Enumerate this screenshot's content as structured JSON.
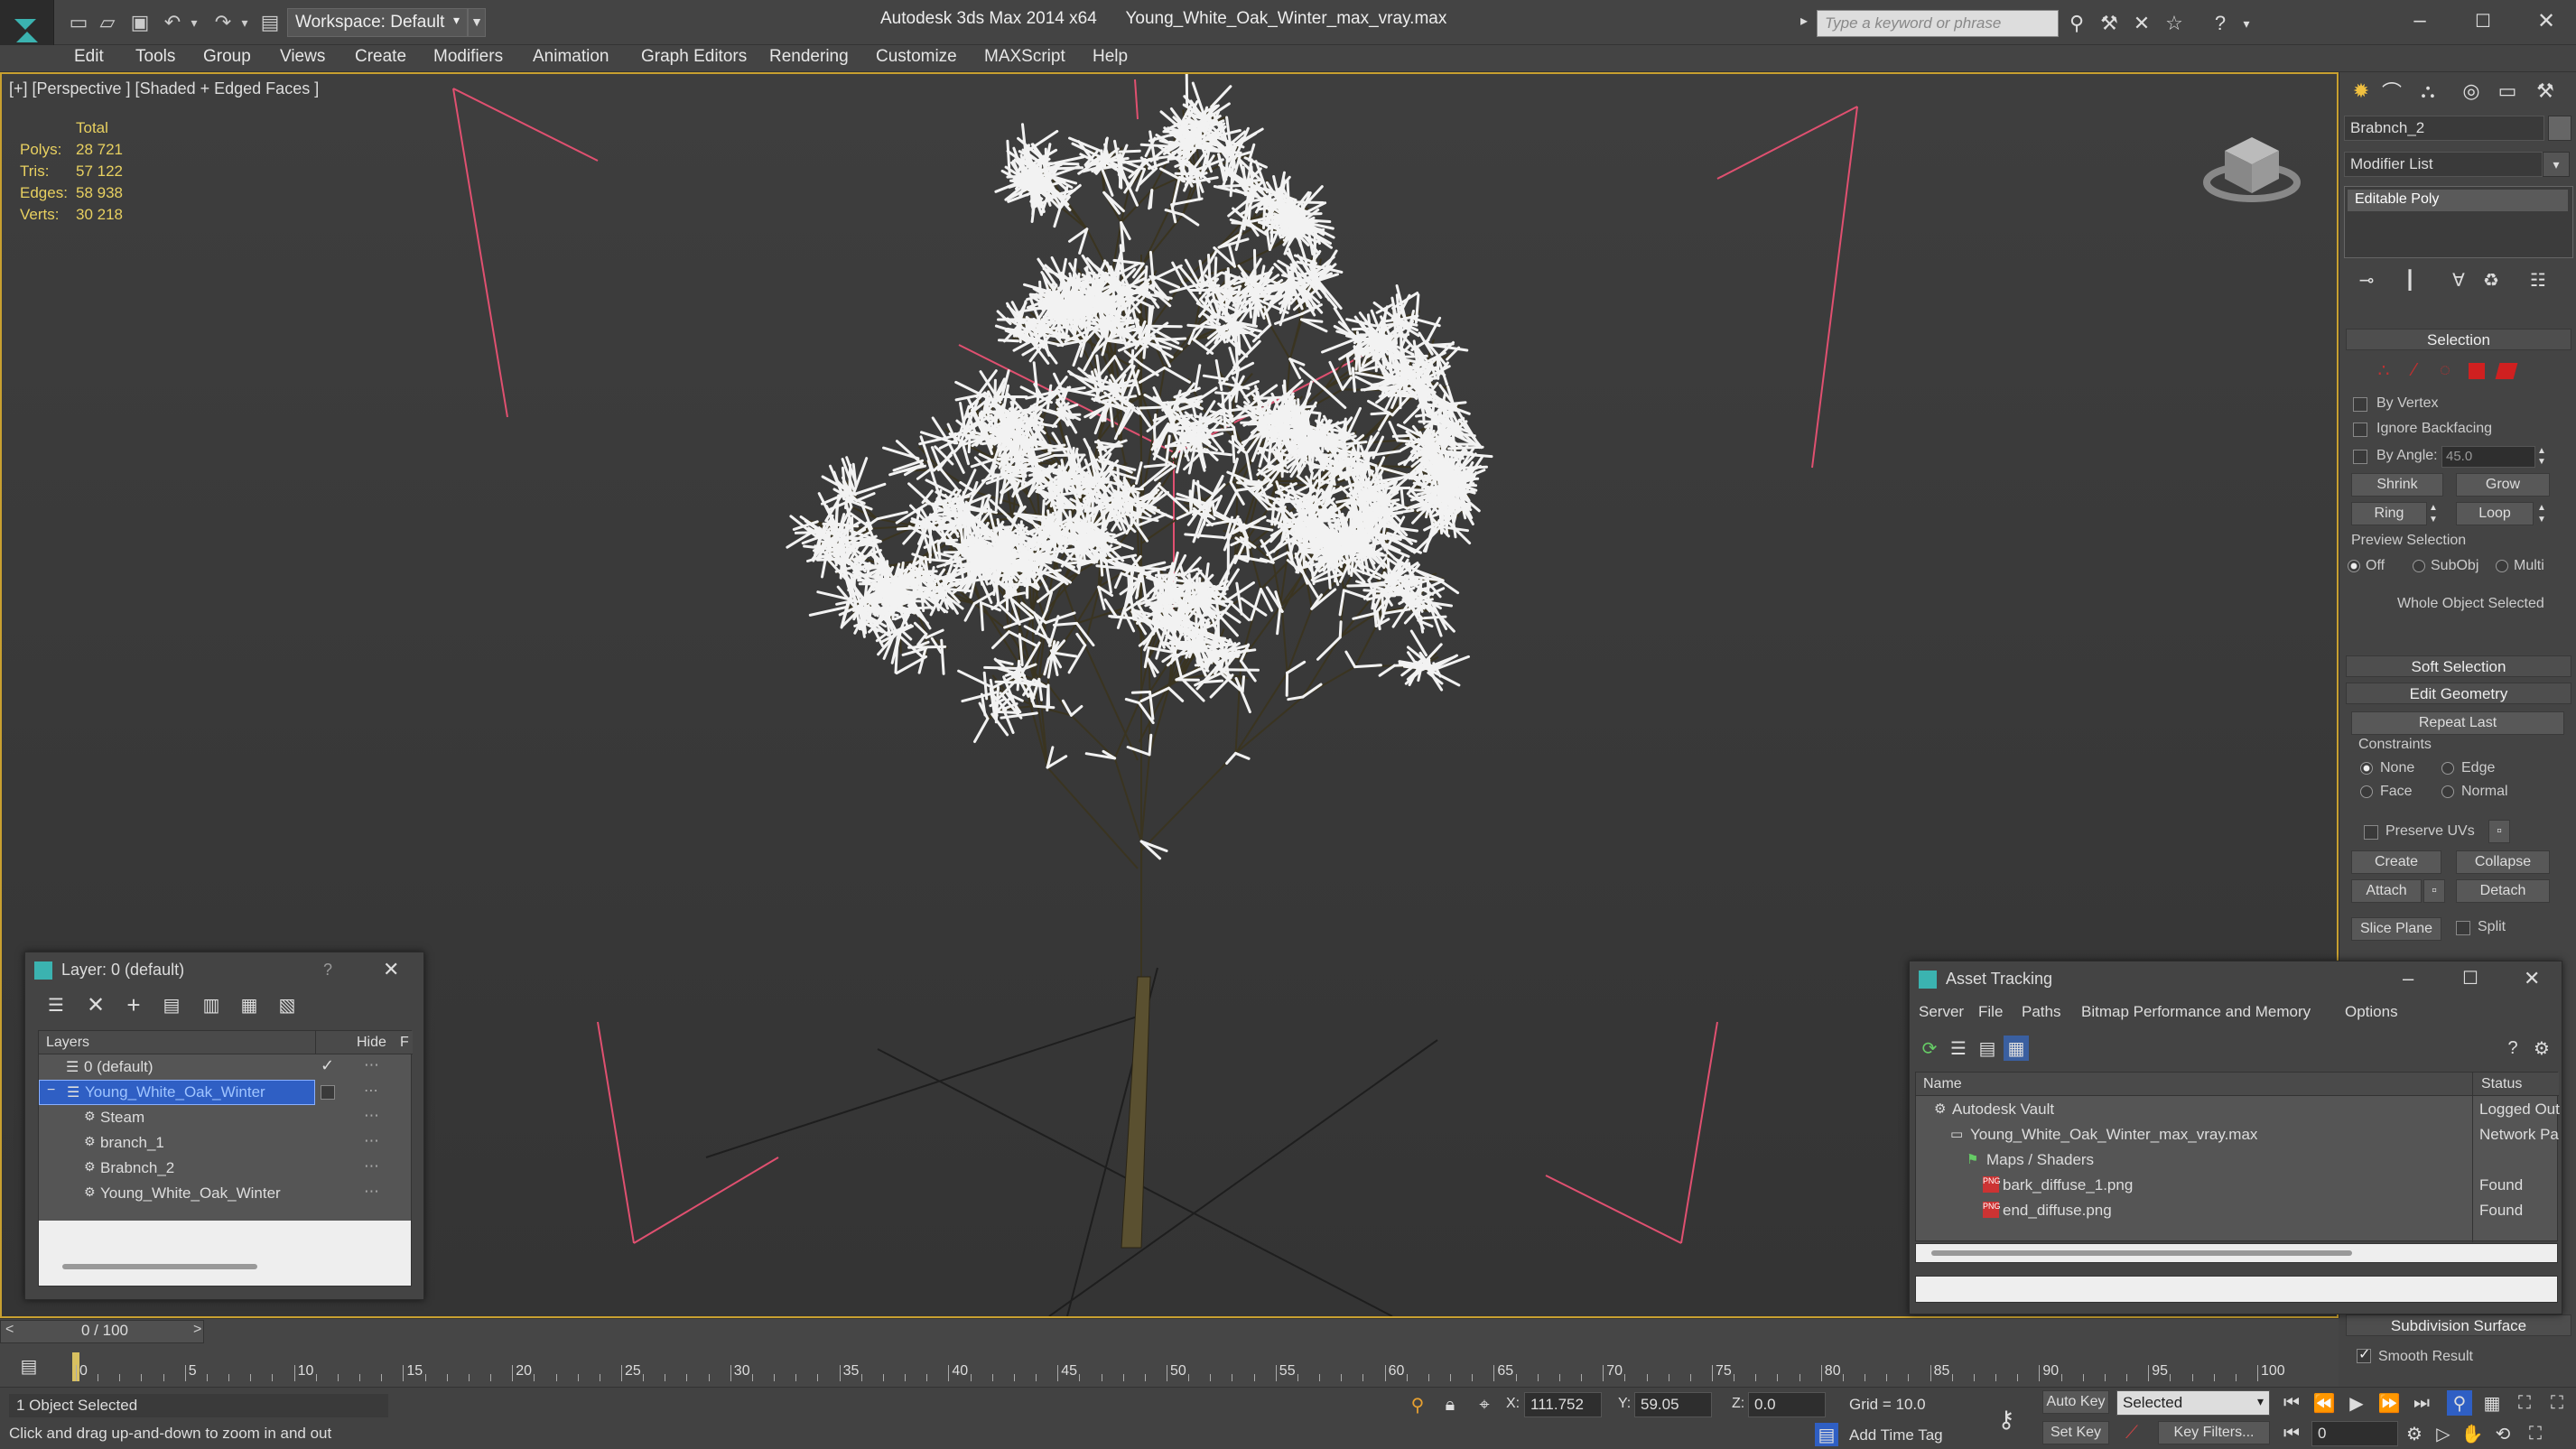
{
  "titlebar": {
    "workspace": "Workspace: Default",
    "app_title": "Autodesk 3ds Max  2014 x64",
    "file_title": "Young_White_Oak_Winter_max_vray.max",
    "search_placeholder": "Type a keyword or phrase"
  },
  "menu": [
    "Edit",
    "Tools",
    "Group",
    "Views",
    "Create",
    "Modifiers",
    "Animation",
    "Graph Editors",
    "Rendering",
    "Customize",
    "MAXScript",
    "Help"
  ],
  "viewport": {
    "label": "[+] [Perspective ] [Shaded + Edged Faces ]",
    "stats_header": "Total",
    "stats": [
      {
        "label": "Polys:",
        "value": "28 721"
      },
      {
        "label": "Tris:",
        "value": "57 122"
      },
      {
        "label": "Edges:",
        "value": "58 938"
      },
      {
        "label": "Verts:",
        "value": "30 218"
      }
    ]
  },
  "command_panel": {
    "object_name": "Brabnch_2",
    "modifier_list": "Modifier List",
    "stack_item": "Editable Poly",
    "selection_header": "Selection",
    "by_vertex": "By Vertex",
    "ignore_backfacing": "Ignore Backfacing",
    "by_angle": "By Angle:",
    "angle_value": "45.0",
    "shrink": "Shrink",
    "grow": "Grow",
    "ring": "Ring",
    "loop": "Loop",
    "preview_selection": "Preview Selection",
    "preview_off": "Off",
    "preview_subobj": "SubObj",
    "preview_multi": "Multi",
    "whole_object": "Whole Object Selected",
    "soft_selection": "Soft Selection",
    "edit_geometry": "Edit Geometry",
    "repeat_last": "Repeat Last",
    "constraints": "Constraints",
    "c_none": "None",
    "c_edge": "Edge",
    "c_face": "Face",
    "c_normal": "Normal",
    "preserve_uvs": "Preserve UVs",
    "create": "Create",
    "collapse": "Collapse",
    "attach": "Attach",
    "detach": "Detach",
    "slice_plane": "Slice Plane",
    "split": "Split",
    "subdivision_surface": "Subdivision Surface",
    "smooth_result": "Smooth Result"
  },
  "layer_dialog": {
    "title": "Layer: 0 (default)",
    "help": "?",
    "col_layers": "Layers",
    "col_hide": "Hide",
    "col_f": "F",
    "rows": [
      {
        "name": "0 (default)",
        "indent": 1,
        "type": "layer"
      },
      {
        "name": "Young_White_Oak_Winter",
        "indent": 1,
        "type": "layer",
        "selected": true
      },
      {
        "name": "Steam",
        "indent": 2,
        "type": "object"
      },
      {
        "name": "branch_1",
        "indent": 2,
        "type": "object"
      },
      {
        "name": "Brabnch_2",
        "indent": 2,
        "type": "object"
      },
      {
        "name": "Young_White_Oak_Winter",
        "indent": 2,
        "type": "object"
      }
    ]
  },
  "asset_dialog": {
    "title": "Asset Tracking",
    "menus": [
      "Server",
      "File",
      "Paths",
      "Bitmap Performance and Memory",
      "Options"
    ],
    "col_name": "Name",
    "col_status": "Status",
    "rows": [
      {
        "name": "Autodesk Vault",
        "status": "Logged Out",
        "indent": 1
      },
      {
        "name": "Young_White_Oak_Winter_max_vray.max",
        "status": "Network Pa",
        "indent": 2
      },
      {
        "name": "Maps / Shaders",
        "status": "",
        "indent": 3
      },
      {
        "name": "bark_diffuse_1.png",
        "status": "Found",
        "indent": 4
      },
      {
        "name": "end_diffuse.png",
        "status": "Found",
        "indent": 4
      }
    ]
  },
  "timeline": {
    "frame_counter": "0 / 100",
    "ticks": [
      "0",
      "5",
      "10",
      "15",
      "20",
      "25",
      "30",
      "35",
      "40",
      "45",
      "50",
      "55",
      "60",
      "65",
      "70",
      "75",
      "80",
      "85",
      "90",
      "95",
      "100"
    ]
  },
  "status": {
    "selection": "1 Object Selected",
    "hint": "Click and drag up-and-down to zoom in and out",
    "x_label": "X:",
    "x_value": "111.752",
    "y_label": "Y:",
    "y_value": "59.05",
    "z_label": "Z:",
    "z_value": "0.0",
    "grid": "Grid = 10.0",
    "auto_key": "Auto Key",
    "set_key": "Set Key",
    "selected": "Selected",
    "key_filters": "Key Filters...",
    "add_time_tag": "Add Time Tag",
    "frame": "0"
  },
  "colors": {
    "accent": "#2f5fc4",
    "viewport_border": "#c8a030",
    "gizmo": "#e05070",
    "stat_text": "#e8d060"
  }
}
